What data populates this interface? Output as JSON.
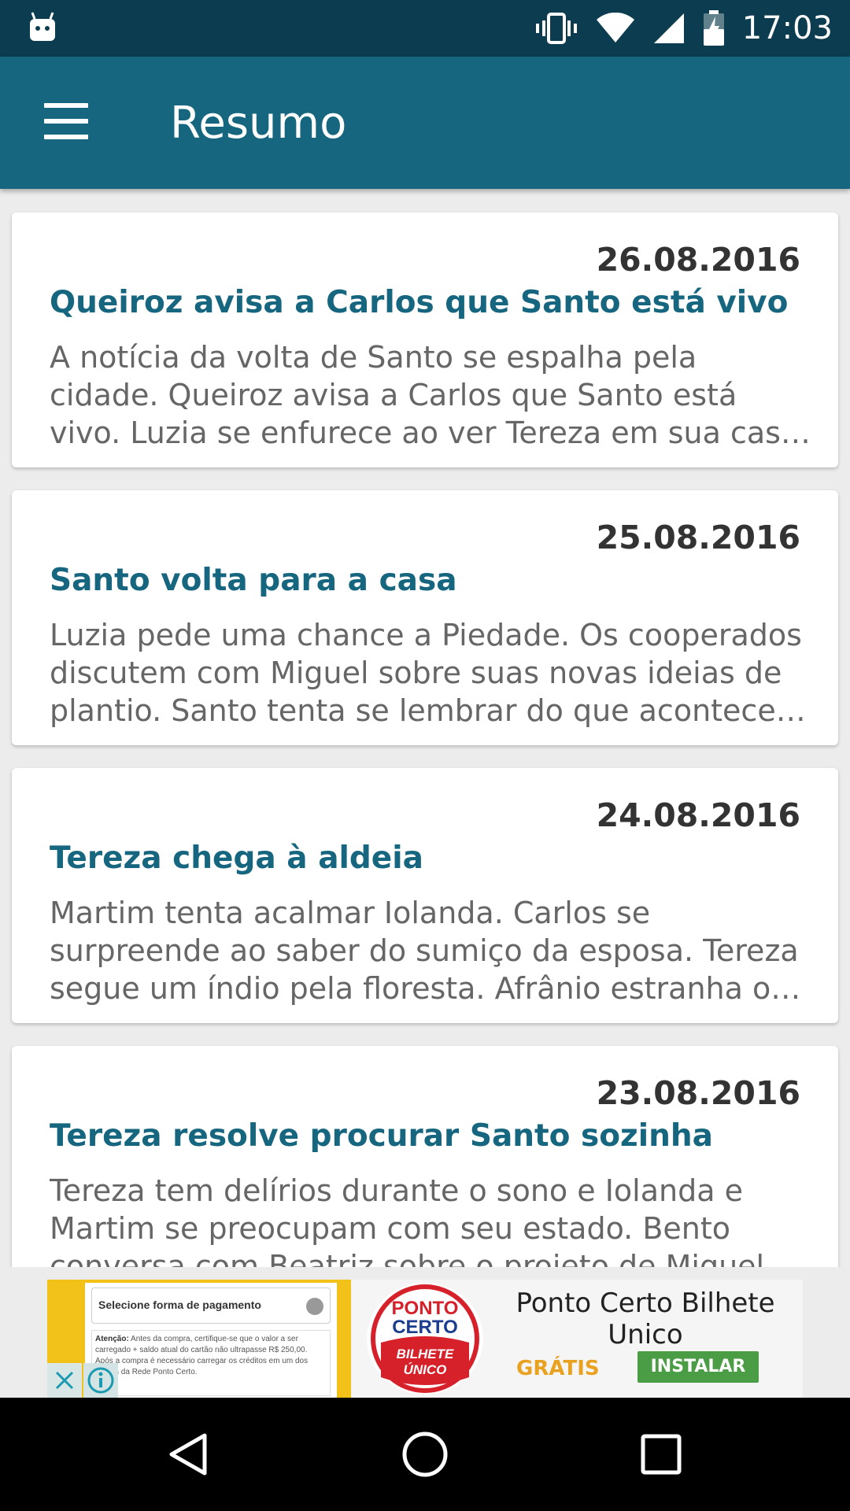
{
  "status_bar": {
    "time": "17:03",
    "icons": [
      "android-robot-icon",
      "vibrate-icon",
      "wifi-icon",
      "signal-icon",
      "battery-charging-icon"
    ]
  },
  "app_bar": {
    "title": "Resumo",
    "menu_icon": "hamburger-menu-icon"
  },
  "summaries": [
    {
      "date": "26.08.2016",
      "title": "Queiroz avisa a Carlos que Santo está vivo",
      "text": "A notícia da volta de Santo se espalha pela cidade. Queiroz avisa a Carlos que Santo está vivo. Luzia se enfurece ao ver Tereza em sua casa. Todos qu…"
    },
    {
      "date": "25.08.2016",
      "title": "Santo volta para a casa",
      "text": "Luzia pede uma chance a Piedade. Os cooperados discutem com Miguel sobre suas novas ideias de plantio. Santo tenta se lembrar do que aconteceu …"
    },
    {
      "date": "24.08.2016",
      "title": "Tereza chega à aldeia",
      "text": "Martim tenta acalmar Iolanda. Carlos se surpreende ao saber do sumiço da esposa. Tereza segue um índio pela floresta. Afrânio estranha o c…"
    },
    {
      "date": "23.08.2016",
      "title": "Tereza resolve procurar Santo sozinha",
      "text": "Tereza tem delírios durante o sono e Iolanda e Martim se preocupam com seu estado. Bento conversa com Beatriz sobre o projeto de Miguel p…"
    }
  ],
  "ad": {
    "screenshot_select": "Selecione forma de pagamento",
    "screenshot_note_bold": "Atenção:",
    "screenshot_note": " Antes da compra, certifique-se que o valor a ser carregado + saldo atual do cartão não ultrapasse R$ 250,00. Após a compra é necessário carregar os créditos em um dos pontos da Rede Ponto Certo.",
    "logo_line1": "PONTO",
    "logo_line2": "CERTO",
    "logo_line3": "BILHETE",
    "logo_line4": "ÚNICO",
    "app_name": "Ponto Certo Bilhete Unico",
    "price": "GRÁTIS",
    "install_label": "INSTALAR",
    "close_icon": "close-icon",
    "info_icon": "info-icon"
  },
  "nav_bar": {
    "icons": [
      "back-icon",
      "home-icon",
      "recents-icon"
    ]
  },
  "colors": {
    "status_bar": "#0c3c4f",
    "app_bar": "#16667f",
    "title_text": "#16667f",
    "background": "#ececec"
  }
}
